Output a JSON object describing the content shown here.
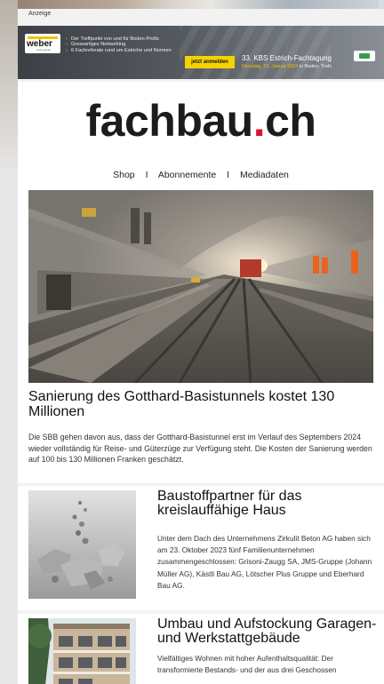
{
  "ad": {
    "label": "Anzeige",
    "brand": "weber",
    "brand_sub": "saint-gobain",
    "bullets": [
      "Der Treffpunkt von und für Boden-Profis",
      "Grossartiges Networking",
      "6 Fachreferate rund um Estriche und Normen"
    ],
    "cta": "jetzt anmelden",
    "event_title": "33. KBS Estrich-Fachtagung",
    "event_date_hl": "Dienstag, 23. Januar 2024",
    "event_date_rest": " in Baden, Trafo"
  },
  "site": {
    "logo_main": "fachbau",
    "logo_dot": ".",
    "logo_tld": "ch",
    "brand_color": "#e2122b"
  },
  "nav": {
    "items": [
      "Shop",
      "Abonnemente",
      "Mediadaten"
    ],
    "separator": "I"
  },
  "main_article": {
    "image": "tunnel-photo",
    "title": "Sanierung des Gotthard-Basistunnels kostet 130 Millionen",
    "text": "Die SBB gehen davon aus, dass der Gotthard-Basistunnel erst im Verlauf des Septembers 2024 wieder vollständig für Reise- und Güterzüge zur Verfügung steht. Die Kosten der Sanierung werden auf 100 bis 130 Millionen Franken geschätzt."
  },
  "articles": [
    {
      "image": "concrete-rubble-photo",
      "title": "Baustoffpartner für das kreislauffähige Haus",
      "text": "Unter dem Dach des Unternehmens Zirkulit Beton AG haben sich am 23. Oktober 2023 fünf Familienunternehmen zusammengeschlossen: Grisoni-Zaugg SA, JMS-Gruppe (Johann Müller AG), Kästli Bau AG, Lötscher Plus Gruppe und Eberhard Bau AG."
    },
    {
      "image": "apartment-building-photo",
      "title": "Umbau und Aufstockung Garagen- und Werkstattgebäude",
      "text": "Vielfältiges Wohnen mit hoher Aufenthaltsqualität: Der transformierte Bestands- und der aus drei Geschossen"
    }
  ]
}
